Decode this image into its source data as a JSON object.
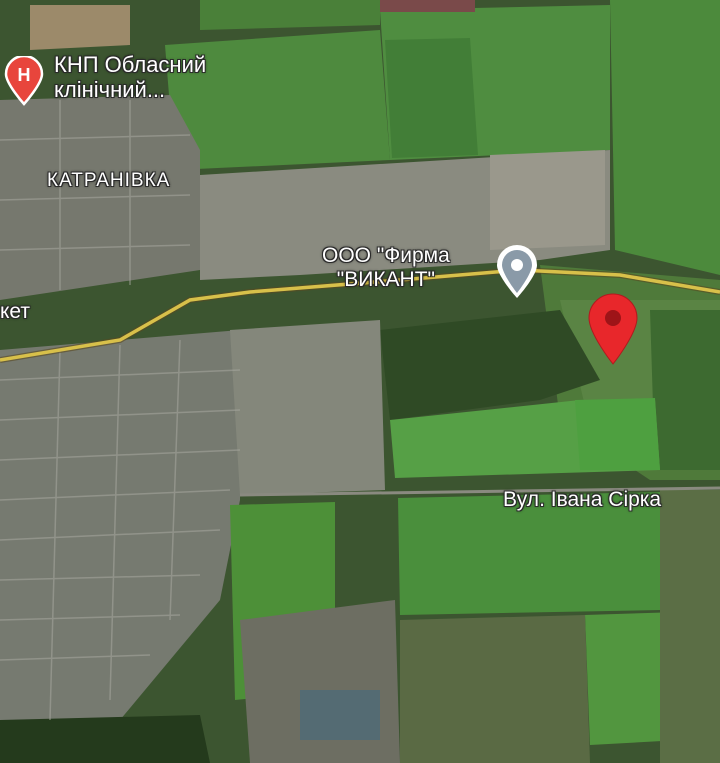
{
  "map": {
    "type": "satellite",
    "pois": {
      "hospital": {
        "name_line1": "КНП Обласний",
        "name_line2": "клінічний...",
        "icon": "hospital-icon",
        "icon_letter": "H",
        "color": "#e8453c"
      },
      "firm": {
        "name_line1": "ООО \"Фирма",
        "name_line2": "\"ВИКАНТ\"",
        "icon": "place-pin-icon",
        "color": "#8a9aa8"
      }
    },
    "district_label": "КАТРАНІВКА",
    "street_label": "Вул. Івана Сірка",
    "partial_label": "кет",
    "selected_location": {
      "icon": "red-location-pin-icon",
      "color": "#e8272b"
    },
    "road_color": "#d8c04a"
  }
}
